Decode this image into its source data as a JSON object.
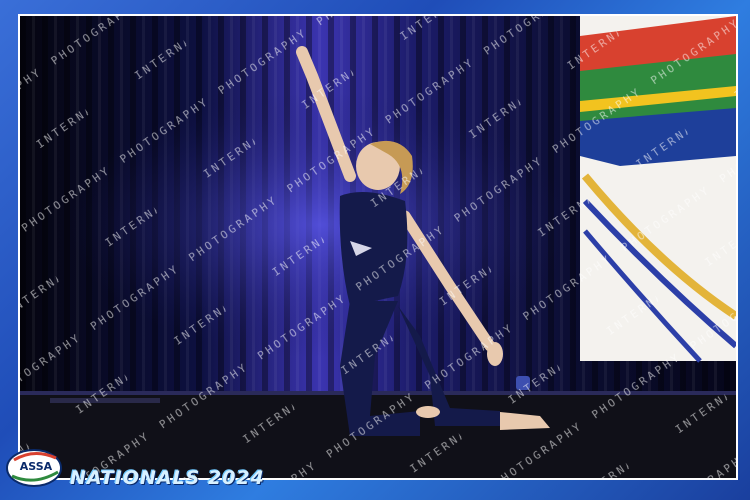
{
  "brand": {
    "logo_text": "ASSA",
    "event_caption": "NATIONALS 2024"
  },
  "watermark": {
    "text": "INTERNAL PHOTOGRAPHY"
  },
  "colors": {
    "frame_blue": "#1f4db8",
    "caption_text": "#d8f0ff"
  }
}
